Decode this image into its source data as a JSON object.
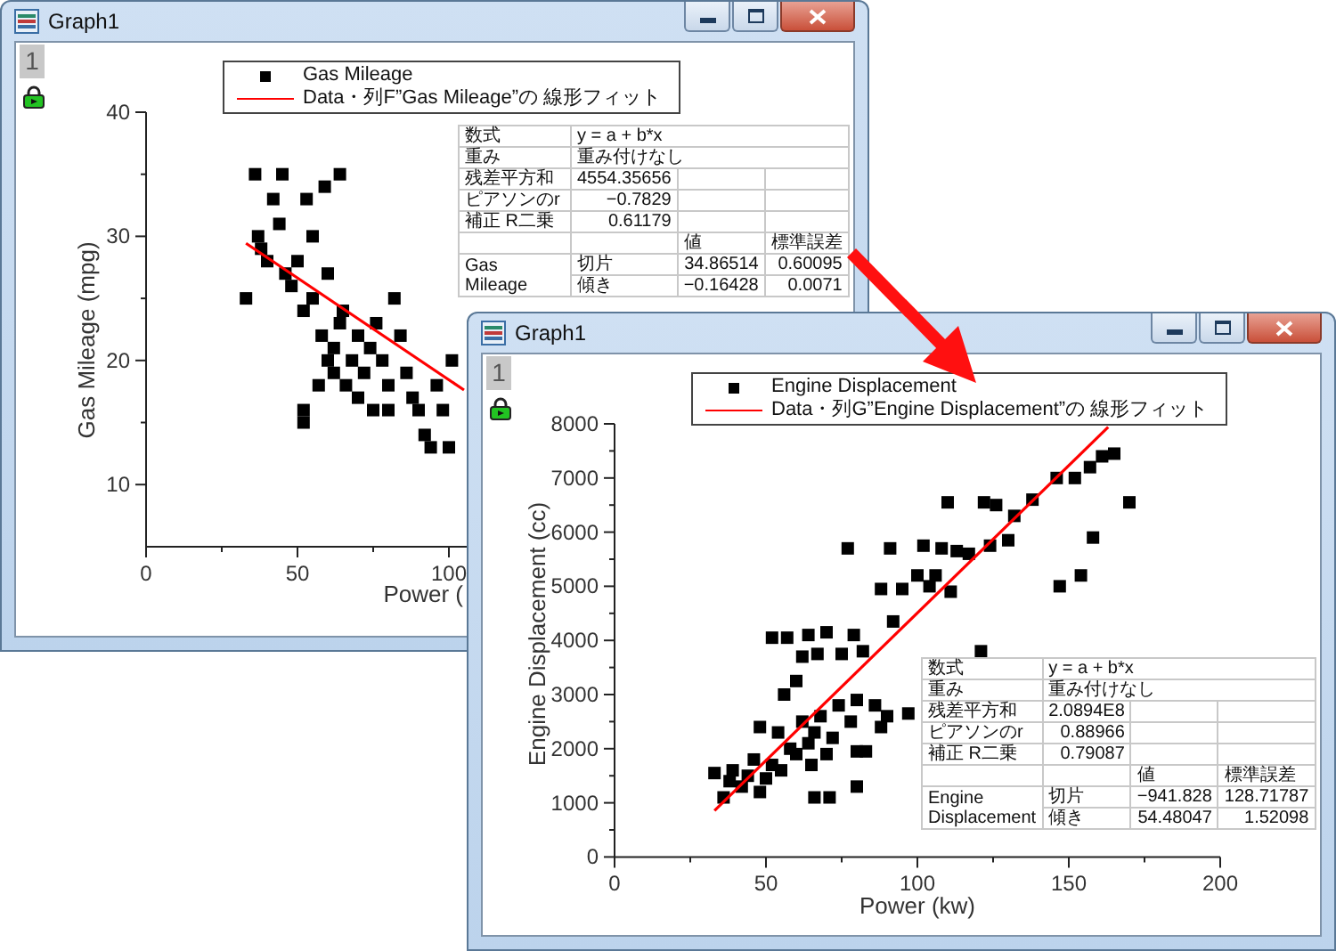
{
  "windows": [
    {
      "title": "Graph1",
      "layer": "1",
      "fit_line": {
        "color": "#ff0000"
      },
      "legend": [
        {
          "kind": "symbol"
        },
        {
          "kind": "line",
          "label": "Data・列F”Gas Mileage”の 線形フィット"
        }
      ],
      "fit_table": {
        "equation_label": "数式",
        "equation": "y = a + b*x",
        "weight_label": "重み",
        "weight": "重み付けなし",
        "stats": [
          {
            "label": "残差平方和",
            "value": "4554.35656"
          },
          {
            "label": "ピアソンのr",
            "value": "−0.7829"
          },
          {
            "label": "補正 R二乗",
            "value": "0.61179"
          }
        ],
        "header": [
          "値",
          "標準誤差"
        ],
        "group": "Gas Mileage",
        "params": [
          {
            "label": "切片",
            "value": "34.86514",
            "error": "0.60095"
          },
          {
            "label": "傾き",
            "value": "−0.16428",
            "error": "0.0071"
          }
        ]
      },
      "chart_data": {
        "type": "scatter",
        "xlabel": "Power (",
        "ylabel": "Gas Mileage (mpg)",
        "xlim": [
          0,
          106
        ],
        "ylim": [
          5,
          40
        ],
        "xticks": [
          0,
          50,
          100
        ],
        "yticks": [
          10,
          20,
          30,
          40
        ],
        "x": [
          33,
          36,
          37,
          38,
          40,
          42,
          44,
          45,
          46,
          48,
          50,
          52,
          52,
          52,
          53,
          55,
          55,
          57,
          58,
          59,
          60,
          60,
          62,
          62,
          64,
          64,
          65,
          66,
          68,
          70,
          70,
          72,
          74,
          75,
          76,
          78,
          80,
          80,
          82,
          84,
          86,
          88,
          90,
          92,
          94,
          96,
          98,
          100,
          101
        ],
        "series": [
          {
            "name": "Gas Mileage",
            "color": "#000000",
            "values": [
              25,
              35,
              30,
              29,
              28,
              33,
              31,
              35,
              27,
              26,
              28,
              24,
              16,
              15,
              33,
              30,
              25,
              18,
              22,
              34,
              27,
              20,
              21,
              19,
              23,
              35,
              24,
              18,
              20,
              22,
              17,
              19,
              21,
              16,
              23,
              20,
              18,
              16,
              25,
              22,
              19,
              17,
              16,
              14,
              13,
              18,
              16,
              13,
              20
            ]
          }
        ]
      }
    },
    {
      "title": "Graph1",
      "layer": "1",
      "fit_line": {
        "color": "#ff0000"
      },
      "legend": [
        {
          "kind": "symbol"
        },
        {
          "kind": "line",
          "label": "Data・列G”Engine Displacement”の 線形フィット"
        }
      ],
      "fit_table": {
        "equation_label": "数式",
        "equation": "y = a + b*x",
        "weight_label": "重み",
        "weight": "重み付けなし",
        "stats": [
          {
            "label": "残差平方和",
            "value": "2.0894E8"
          },
          {
            "label": "ピアソンのr",
            "value": "0.88966"
          },
          {
            "label": "補正 R二乗",
            "value": "0.79087"
          }
        ],
        "header": [
          "値",
          "標準誤差"
        ],
        "group": "Engine Displacement",
        "params": [
          {
            "label": "切片",
            "value": "−941.828",
            "error": "128.71787"
          },
          {
            "label": "傾き",
            "value": "54.48047",
            "error": "1.52098"
          }
        ]
      },
      "chart_data": {
        "type": "scatter",
        "xlabel": "Power (kw)",
        "ylabel": "Engine Displacement (cc)",
        "xlim": [
          0,
          200
        ],
        "ylim": [
          0,
          8000
        ],
        "xticks": [
          0,
          50,
          100,
          150,
          200
        ],
        "yticks": [
          0,
          1000,
          2000,
          3000,
          4000,
          5000,
          6000,
          7000,
          8000
        ],
        "x": [
          33,
          36,
          38,
          39,
          42,
          44,
          46,
          48,
          48,
          50,
          52,
          52,
          54,
          55,
          56,
          57,
          58,
          60,
          60,
          62,
          62,
          64,
          64,
          65,
          66,
          66,
          67,
          68,
          70,
          70,
          71,
          72,
          74,
          75,
          77,
          78,
          79,
          80,
          80,
          80,
          82,
          83,
          86,
          88,
          88,
          90,
          91,
          92,
          95,
          97,
          100,
          102,
          104,
          106,
          108,
          110,
          111,
          113,
          117,
          121,
          122,
          124,
          126,
          130,
          132,
          138,
          146,
          147,
          152,
          154,
          157,
          158,
          161,
          165,
          170
        ],
        "series": [
          {
            "name": "Engine Displacement",
            "color": "#000000",
            "values": [
              1550,
              1100,
              1400,
              1600,
              1300,
              1500,
              1800,
              1200,
              2400,
              1450,
              1700,
              4050,
              2300,
              1600,
              3000,
              4050,
              2000,
              1900,
              3250,
              2500,
              3700,
              2100,
              4100,
              1700,
              2300,
              1100,
              3750,
              2600,
              1900,
              4150,
              1100,
              2200,
              2800,
              3750,
              5700,
              2500,
              4100,
              1950,
              2900,
              1300,
              3800,
              1950,
              2800,
              2400,
              4950,
              2600,
              5700,
              4350,
              4950,
              2650,
              5200,
              5750,
              5000,
              5200,
              5700,
              6550,
              4900,
              5650,
              5600,
              3800,
              6550,
              5750,
              6500,
              5850,
              6300,
              6600,
              7000,
              5000,
              7000,
              5200,
              7200,
              5900,
              7400,
              7450,
              6550
            ]
          }
        ]
      }
    }
  ]
}
